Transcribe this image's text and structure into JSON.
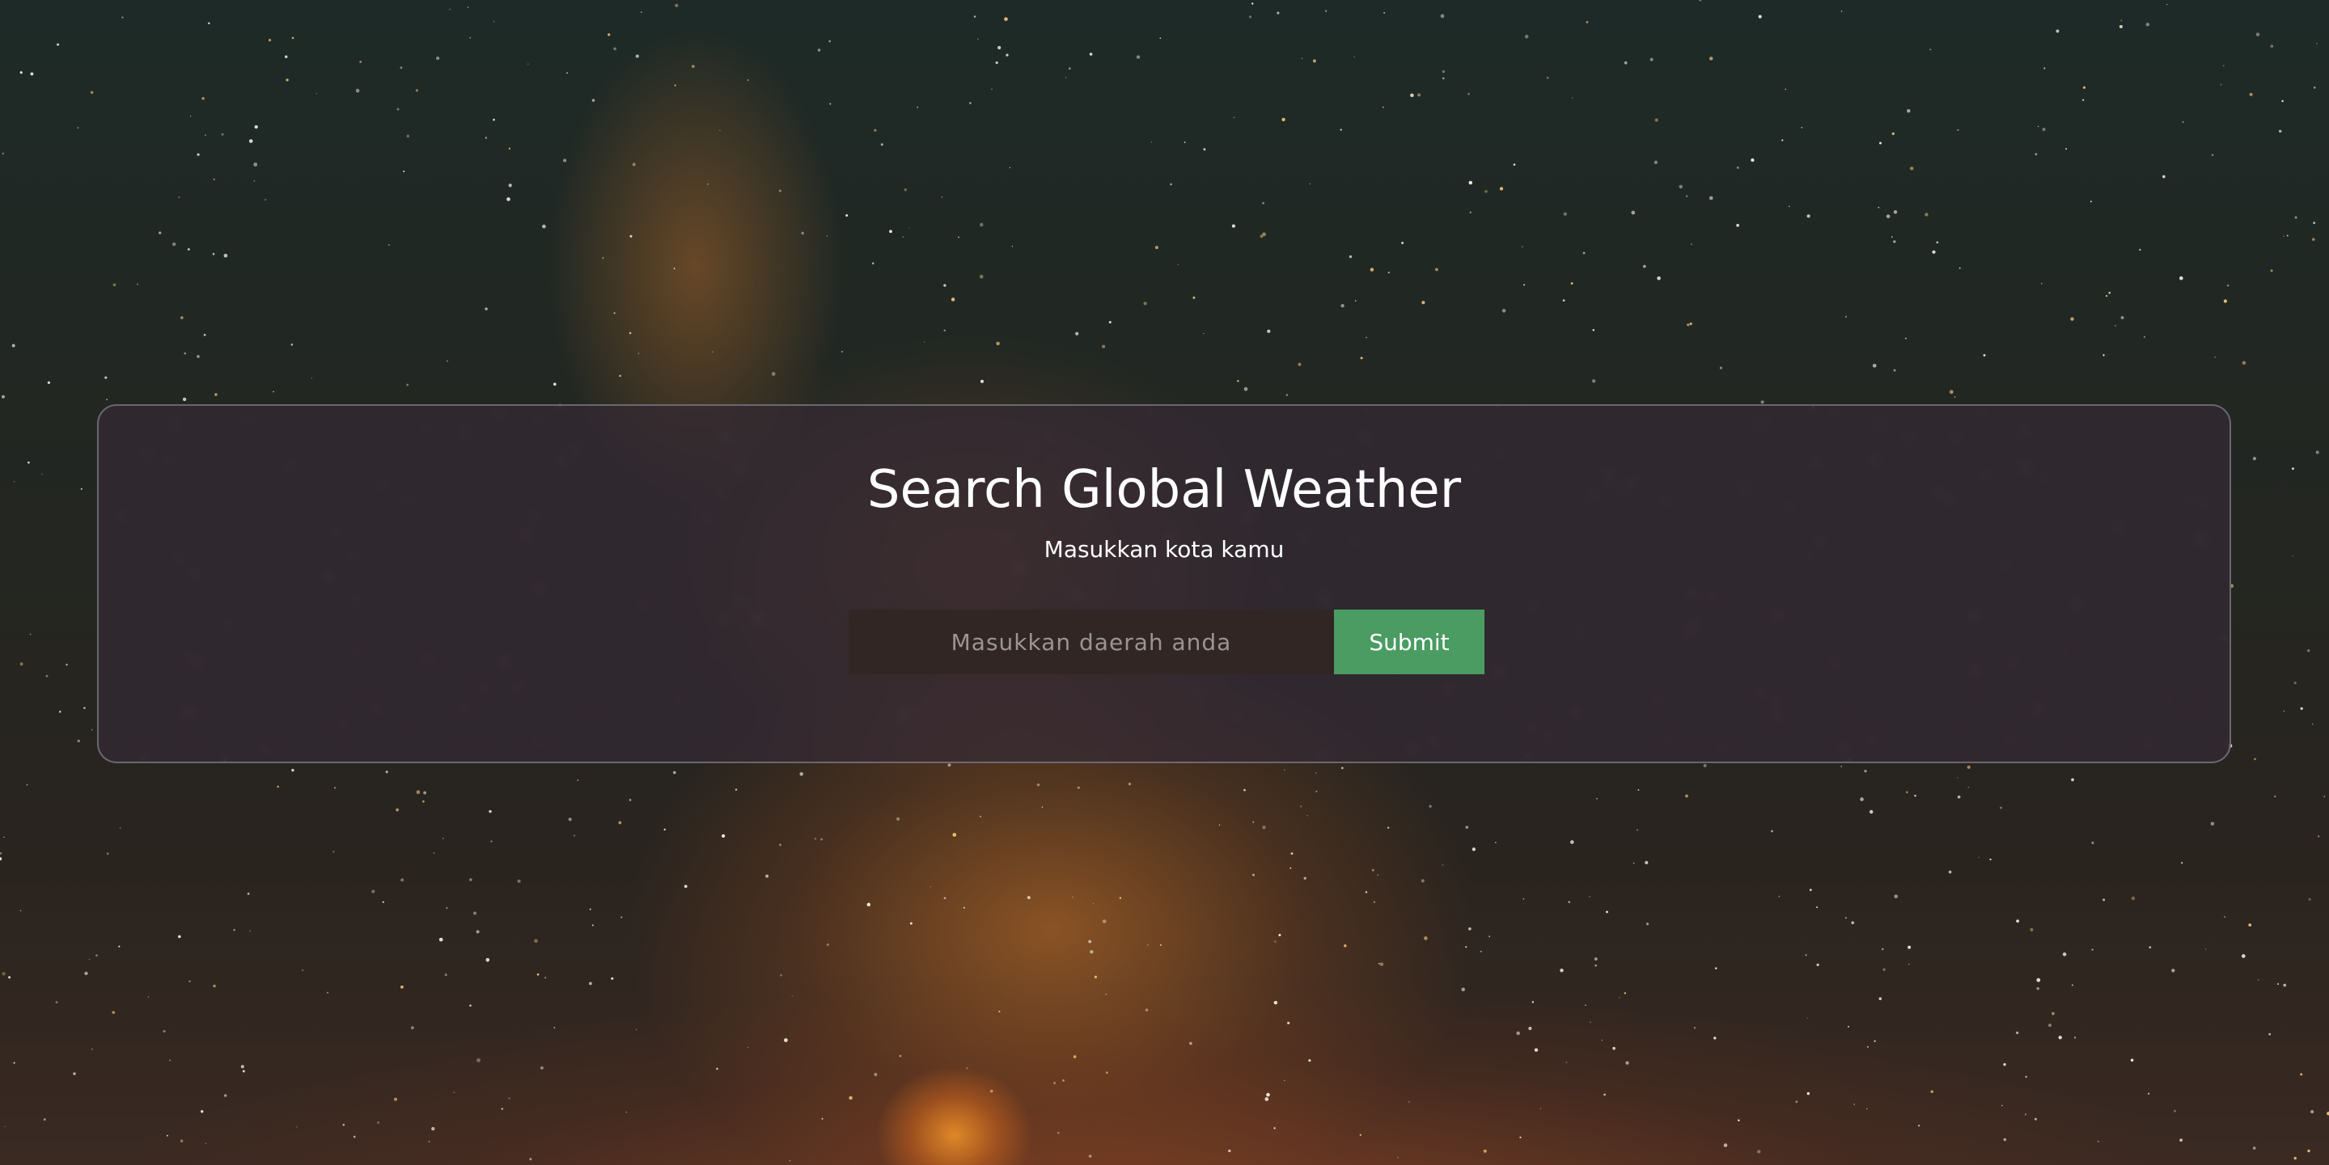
{
  "page": {
    "title": "Search Global Weather",
    "subtitle": "Masukkan kota kamu"
  },
  "search": {
    "value": "",
    "placeholder": "Masukkan daerah anda",
    "submit_label": "Submit"
  },
  "colors": {
    "submit_button": "#4a9c62",
    "text": "#ffffff"
  }
}
